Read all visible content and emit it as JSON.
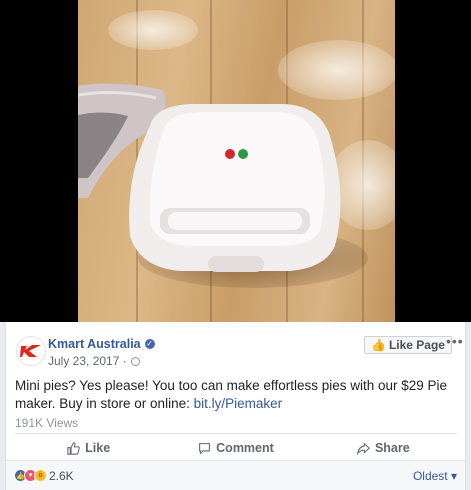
{
  "post": {
    "page_name": "Kmart Australia",
    "date": "July 23, 2017 · ",
    "like_page_label": "Like Page",
    "more_label": "•••",
    "text": "Mini pies? Yes please! You too can make effortless pies with our $29 Pie maker. Buy in store or online: ",
    "link_text": "bit.ly/Piemaker",
    "views": "191K Views"
  },
  "actions": {
    "like": "Like",
    "comment": "Comment",
    "share": "Share"
  },
  "reactions": {
    "count": "2.6K",
    "sort_label": "Oldest",
    "icons": [
      "like-icon",
      "love-icon",
      "wow-icon"
    ]
  },
  "colors": {
    "link": "#365899",
    "brand_red": "#e1261c",
    "fb_blue": "#4267b2"
  }
}
